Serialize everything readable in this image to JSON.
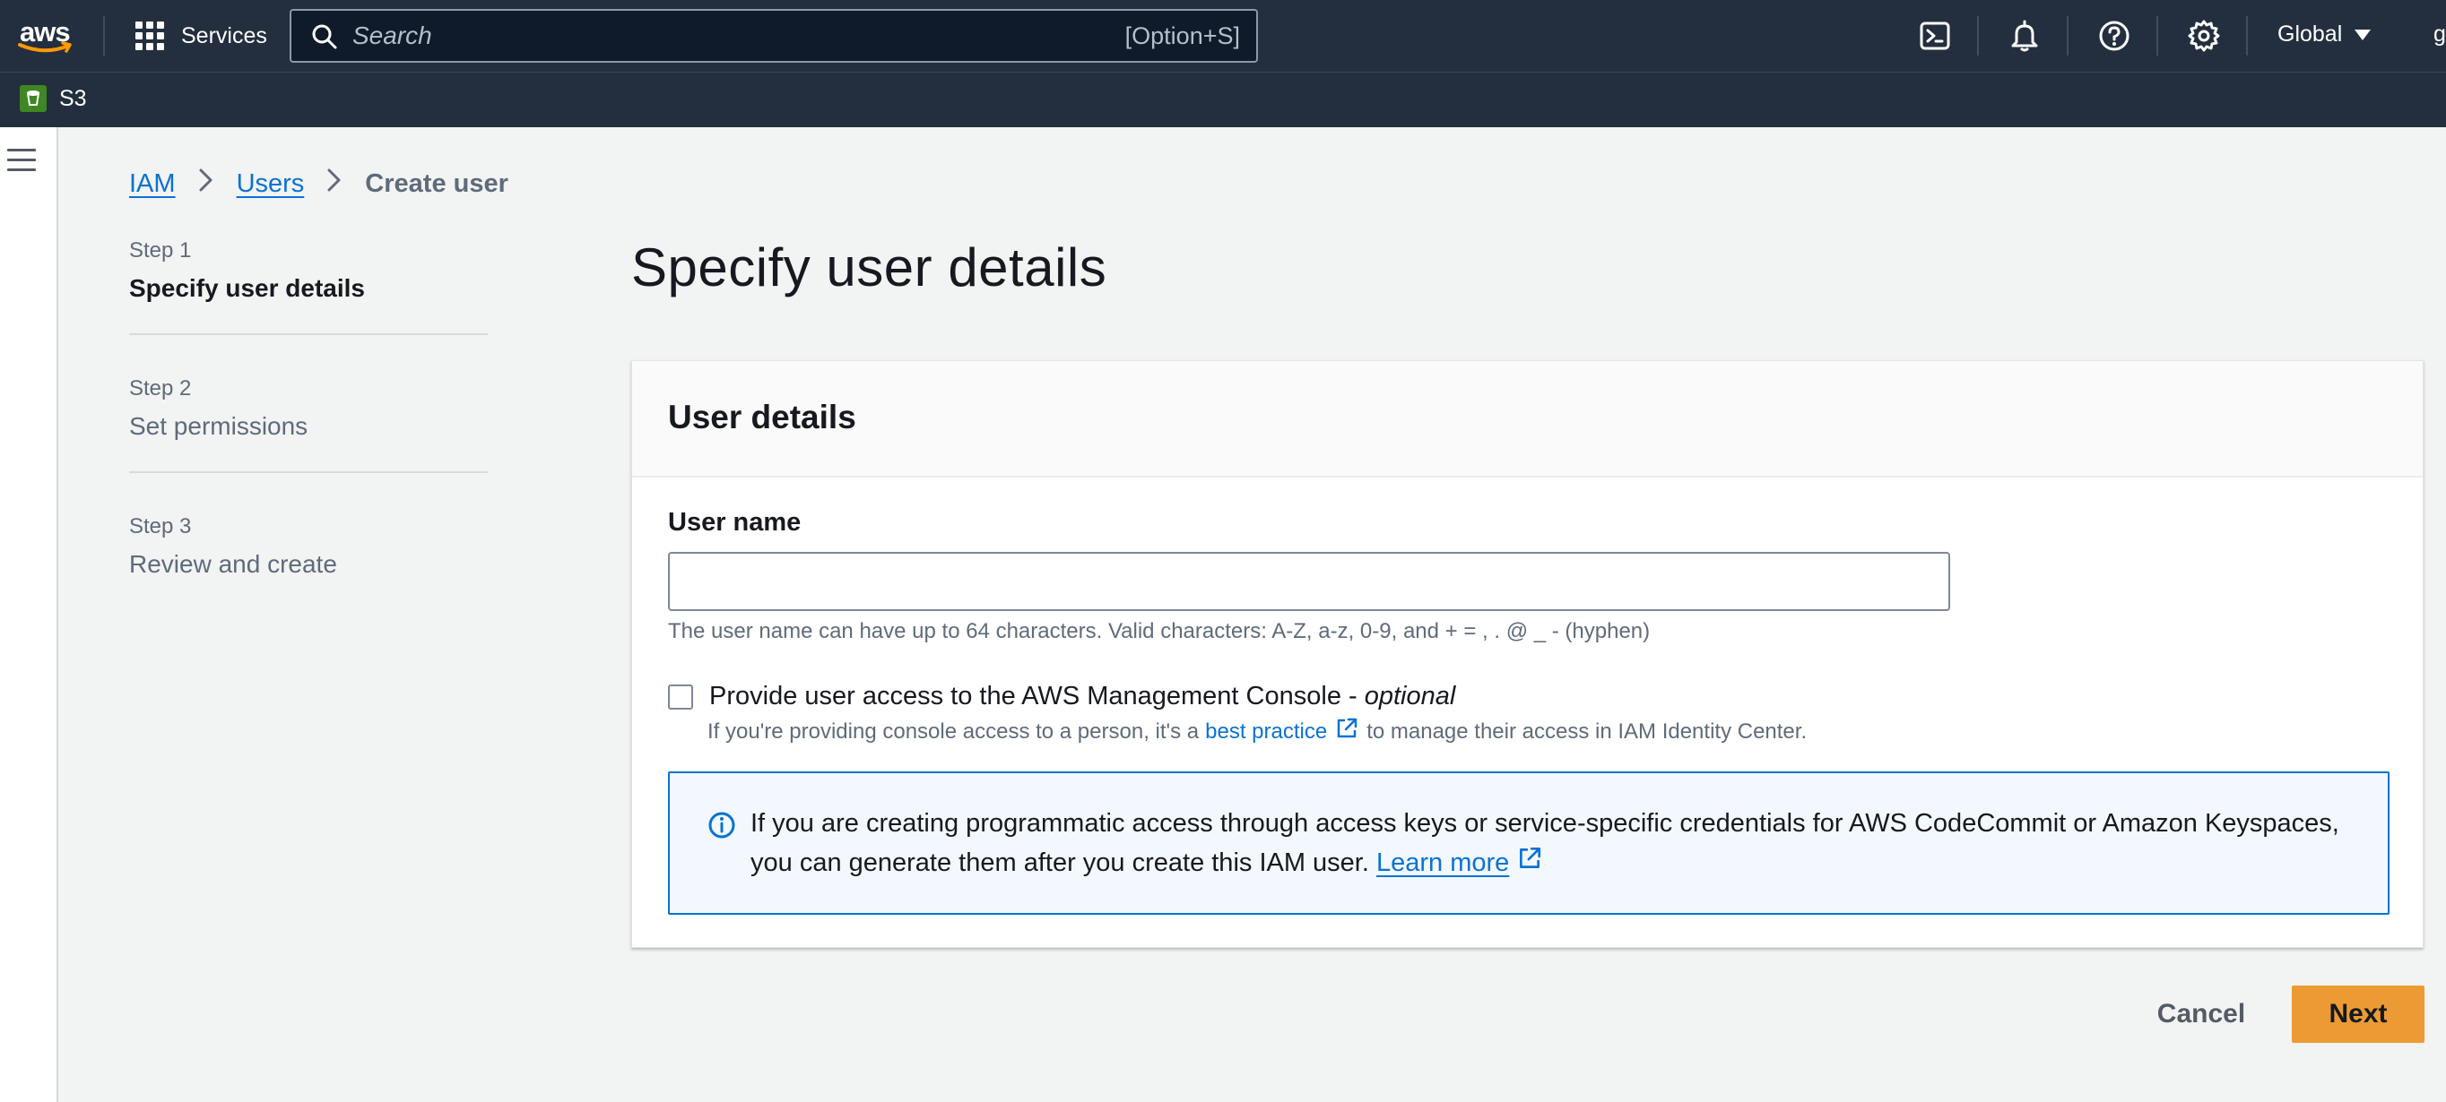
{
  "topnav": {
    "logo_text": "aws",
    "services_label": "Services",
    "search_placeholder": "Search",
    "search_shortcut": "[Option+S]",
    "region_label": "Global",
    "account_label": "g",
    "icons": [
      "cloudshell-icon",
      "notifications-bell-icon",
      "help-icon",
      "settings-gear-icon"
    ]
  },
  "favorites": {
    "items": [
      {
        "label": "S3",
        "icon": "s3-service-icon"
      }
    ]
  },
  "breadcrumb": {
    "items": [
      {
        "label": "IAM",
        "link": true
      },
      {
        "label": "Users",
        "link": true
      },
      {
        "label": "Create user",
        "link": false
      }
    ]
  },
  "steps": [
    {
      "number": "Step 1",
      "title": "Specify user details",
      "active": true
    },
    {
      "number": "Step 2",
      "title": "Set permissions",
      "active": false
    },
    {
      "number": "Step 3",
      "title": "Review and create",
      "active": false
    }
  ],
  "page_title": "Specify user details",
  "panel": {
    "header": "User details",
    "username_label": "User name",
    "username_value": "",
    "username_hint": "The user name can have up to 64 characters. Valid characters: A-Z, a-z, 0-9, and + = , . @ _ - (hyphen)",
    "console_access_label": "Provide user access to the AWS Management Console - ",
    "console_access_optional": "optional",
    "console_access_checked": false,
    "console_desc_prefix": "If you're providing console access to a person, it's a",
    "console_desc_link": "best practice",
    "console_desc_suffix": "to manage their access in IAM Identity Center.",
    "info_message": "If you are creating programmatic access through access keys or service-specific credentials for AWS CodeCommit or Amazon Keyspaces, you can generate them after you create this IAM user.",
    "info_link": "Learn more"
  },
  "actions": {
    "cancel_label": "Cancel",
    "next_label": "Next"
  },
  "colors": {
    "nav_bg": "#232f3e",
    "link": "#0972d3",
    "primary_button": "#ec9b34",
    "info_bg": "#f2f8fd"
  }
}
